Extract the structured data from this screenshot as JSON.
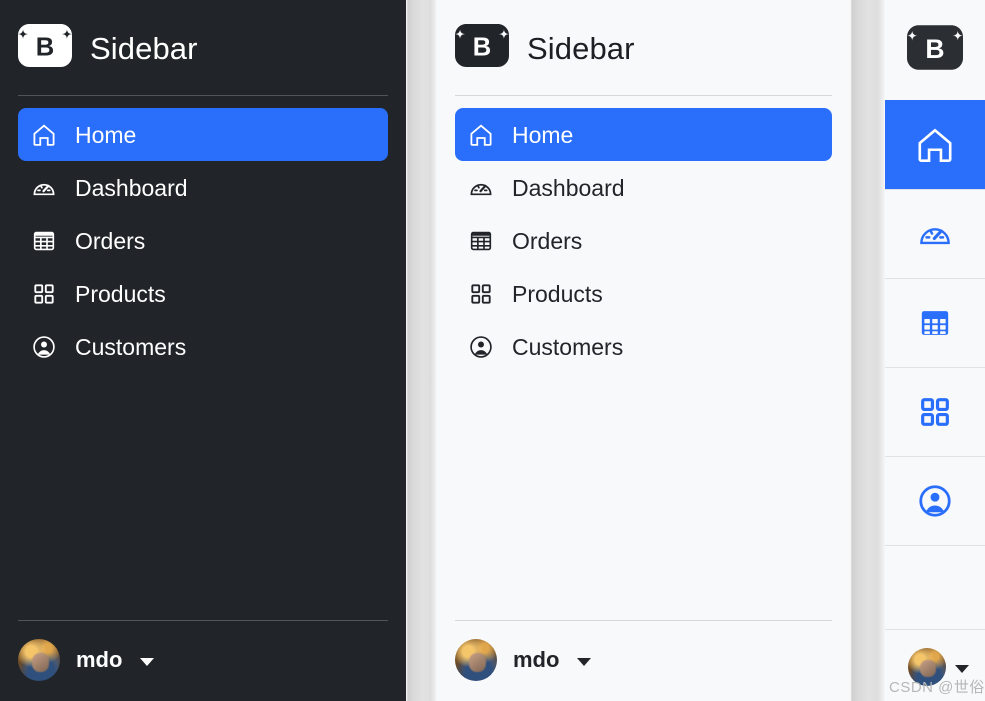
{
  "brand": {
    "logo_icon": "bootstrap-b-logo",
    "title": "Sidebar"
  },
  "colors": {
    "accent": "#2a6ffc",
    "dark_bg": "#212529",
    "light_bg": "#f8f9fa",
    "dark_text": "#212529",
    "light_text": "#ffffff"
  },
  "nav": {
    "items": [
      {
        "label": "Home",
        "icon": "house-icon",
        "active": true
      },
      {
        "label": "Dashboard",
        "icon": "speedometer-icon",
        "active": false
      },
      {
        "label": "Orders",
        "icon": "table-icon",
        "active": false
      },
      {
        "label": "Products",
        "icon": "grid-icon",
        "active": false
      },
      {
        "label": "Customers",
        "icon": "person-circle-icon",
        "active": false
      }
    ]
  },
  "footer": {
    "avatar_icon": "user-avatar",
    "username": "mdo",
    "caret_icon": "caret-down-icon"
  },
  "dark_sidebar": {
    "title": "Sidebar"
  },
  "light_sidebar": {
    "title": "Sidebar"
  },
  "icon_sidebar": {
    "logo_icon": "bootstrap-b-logo",
    "items": [
      {
        "icon": "house-icon",
        "active": true
      },
      {
        "icon": "speedometer-icon",
        "active": false
      },
      {
        "icon": "table-icon",
        "active": false
      },
      {
        "icon": "grid-icon",
        "active": false
      },
      {
        "icon": "person-circle-icon",
        "active": false
      }
    ]
  },
  "watermark": {
    "text": "CSDN @世俗"
  }
}
